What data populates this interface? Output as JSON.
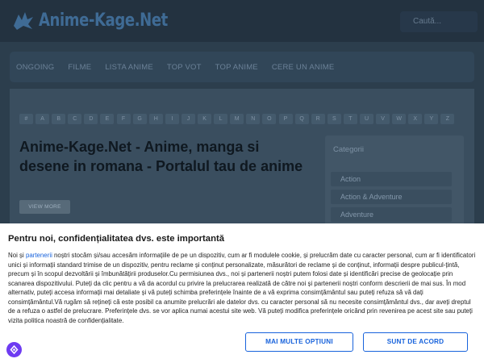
{
  "header": {
    "logo_text": "Anime-Kage.Net",
    "search_placeholder": "Caută..."
  },
  "nav": {
    "items": [
      "ONGOING",
      "FILME",
      "LISTA ANIME",
      "TOP VOT",
      "TOP ANIME",
      "CERE UN ANIME"
    ]
  },
  "alphabet": [
    "#",
    "A",
    "B",
    "C",
    "D",
    "E",
    "F",
    "G",
    "H",
    "I",
    "J",
    "K",
    "L",
    "M",
    "N",
    "O",
    "P",
    "Q",
    "R",
    "S",
    "T",
    "U",
    "V",
    "W",
    "X",
    "Y",
    "Z"
  ],
  "main": {
    "title": "Anime-Kage.Net - Anime, manga si desene in romana - Portalul tau de anime",
    "view_more": "VIEW MORE"
  },
  "sidebar": {
    "heading": "Categorii",
    "categories": [
      "Action",
      "Action & Adventure",
      "Adventure"
    ]
  },
  "consent": {
    "title": "Pentru noi, confidențialitatea dvs. este importantă",
    "body_prefix": "Noi și ",
    "link_text": "partenerii",
    "body_rest": " noștri stocăm și/sau accesăm informațiile de pe un dispozitiv, cum ar fi modulele cookie, și prelucrăm date cu caracter personal, cum ar fi identificatori unici și informații standard trimise de un dispozitiv, pentru reclame și conținut personalizate, măsurători de reclame și de conținut, informații despre publicul-țintă, precum și în scopul dezvoltării și îmbunătățirii produselor.Cu permisiunea dvs., noi și partenerii noștri putem folosi date și identificări precise de geolocație prin scanarea dispozitivului. Puteți da clic pentru a vă da acordul cu privire la prelucrarea realizată de către noi și partenerii noștri conform descrierii de mai sus. În mod alternativ, puteți accesa informații mai detaliate și vă puteți schimba preferințele înainte de a vă exprima consimțământul sau puteți refuza să vă dați consimțământul.Vă rugăm să rețineți că este posibil ca anumite prelucrări ale datelor dvs. cu caracter personal să nu necesite consimțământul dvs., dar aveți dreptul de a refuza o astfel de prelucrare. Preferințele dvs. se vor aplica numai acestui site web. Vă puteți modifica preferințele oricând prin revenirea pe acest site sau puteți vizita politica noastră de confidențialitate.",
    "more_options_label": "MAI MULTE OPȚIUNI",
    "accept_label": "SUNT DE ACORD"
  },
  "colors": {
    "accent": "#1863dc",
    "fab": "#6e3bf2"
  }
}
